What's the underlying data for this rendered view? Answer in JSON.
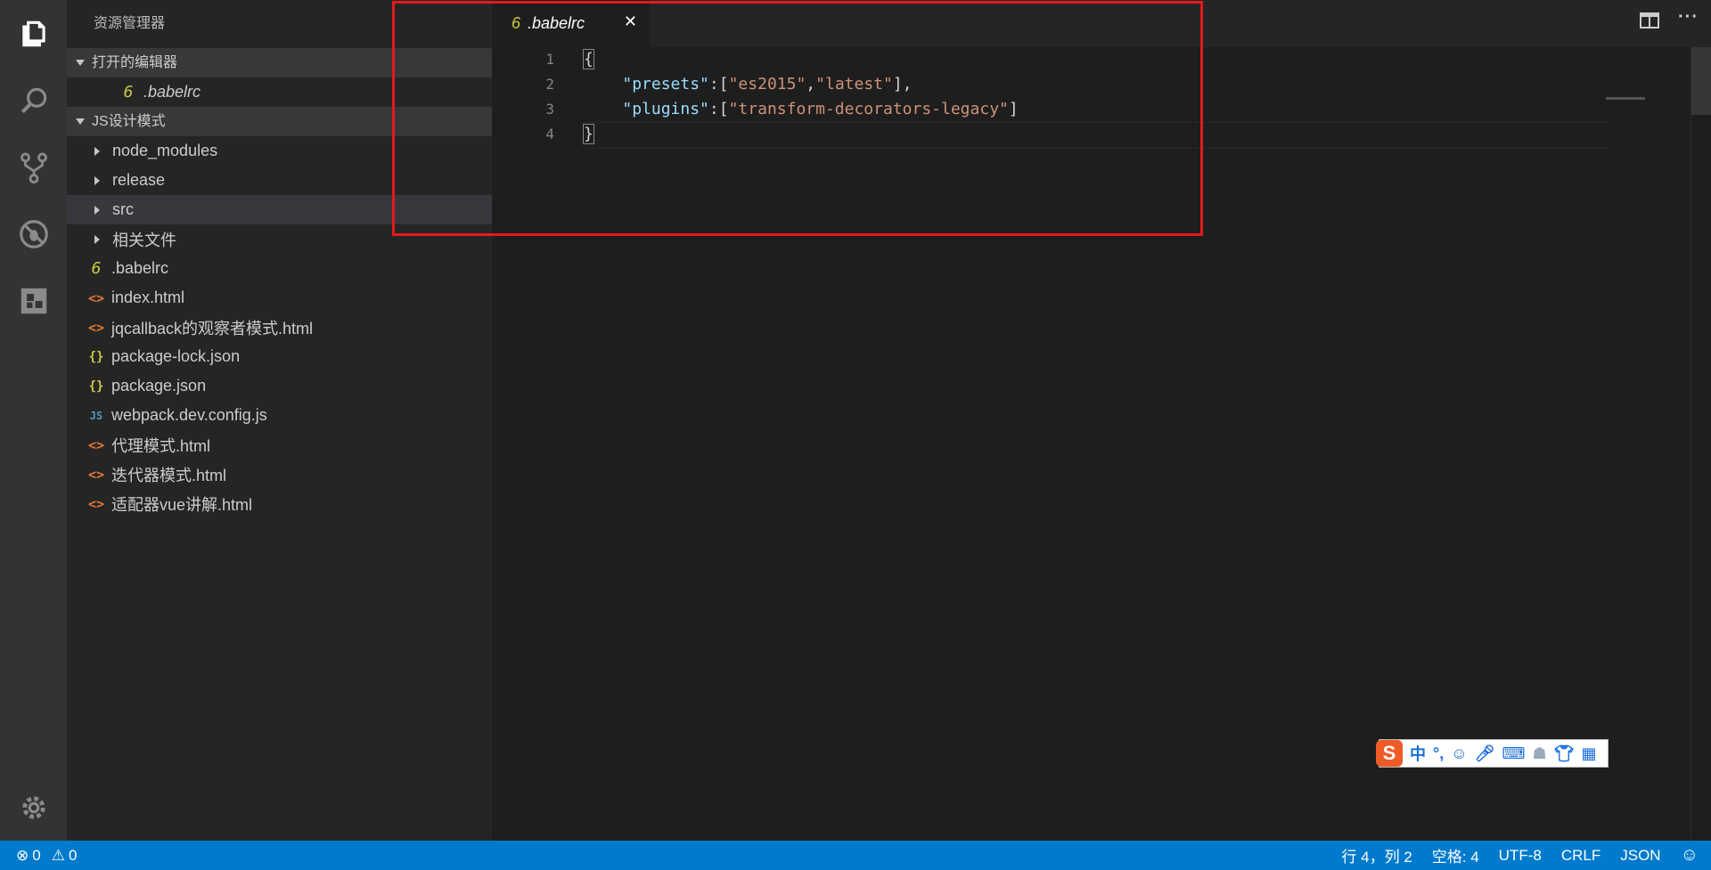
{
  "sidebar": {
    "title": "资源管理器",
    "open_editors": {
      "label": "打开的编辑器",
      "items": [
        {
          "icon": "6",
          "label": ".babelrc"
        }
      ]
    },
    "project": {
      "label": "JS设计模式",
      "folders": [
        "node_modules",
        "release",
        "src",
        "相关文件"
      ],
      "files": [
        {
          "icon": "6",
          "label": ".babelrc"
        },
        {
          "icon": "<>",
          "label": "index.html"
        },
        {
          "icon": "<>",
          "label": "jqcallback的观察者模式.html"
        },
        {
          "icon": "{}",
          "label": "package-lock.json"
        },
        {
          "icon": "{}",
          "label": "package.json"
        },
        {
          "icon": "JS",
          "label": "webpack.dev.config.js"
        },
        {
          "icon": "<>",
          "label": "代理模式.html"
        },
        {
          "icon": "<>",
          "label": "迭代器模式.html"
        },
        {
          "icon": "<>",
          "label": "适配器vue讲解.html"
        }
      ]
    }
  },
  "tab": {
    "icon": "6",
    "label": ".babelrc",
    "close": "✕"
  },
  "editor": {
    "line_numbers": [
      "1",
      "2",
      "3",
      "4"
    ],
    "lines": [
      {
        "t1": "{"
      },
      {
        "indent": "    ",
        "key": "\"presets\"",
        "p1": ":[",
        "v1": "\"es2015\"",
        "c": ",",
        "v2": "\"latest\"",
        "p2": "],"
      },
      {
        "indent": "    ",
        "key": "\"plugins\"",
        "p1": ":[",
        "v1": "\"transform-decorators-legacy\"",
        "p2": "]"
      },
      {
        "t1": "}"
      }
    ]
  },
  "ime": {
    "logo": "S",
    "mode": "中",
    "punct": "°,"
  },
  "status": {
    "errors": "0",
    "warnings": "0",
    "position": "行 4，列 2",
    "indent": "空格: 4",
    "encoding": "UTF-8",
    "eol": "CRLF",
    "language": "JSON"
  },
  "colors": {
    "status_bar": "#007acc",
    "activity_bar": "#333333",
    "sidebar": "#252526",
    "editor": "#1e1e1e",
    "highlight_box": "#e21b1b"
  }
}
